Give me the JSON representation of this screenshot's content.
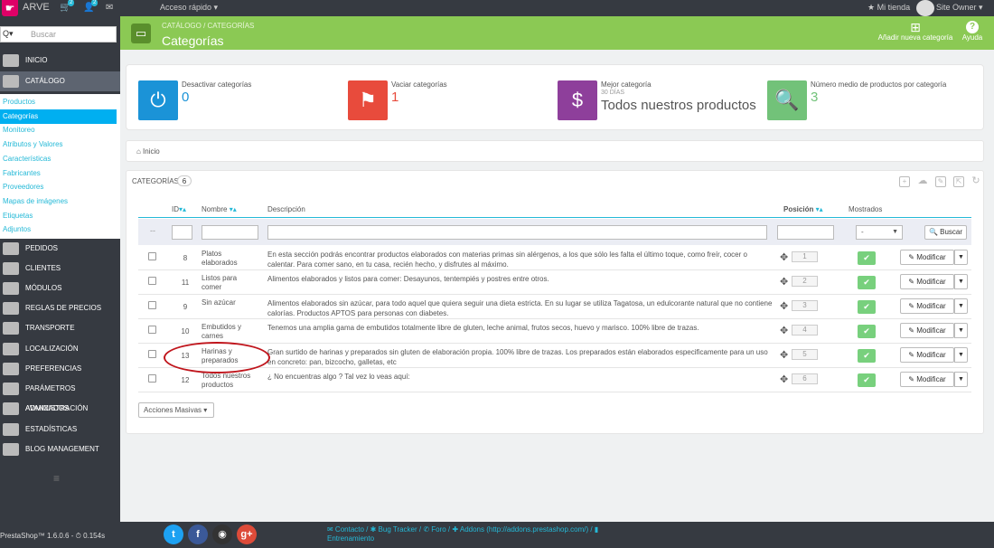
{
  "topbar": {
    "brand": "ARVE",
    "cart_badge": "2",
    "users_badge": "2",
    "quick_access": "Acceso rápido ▾",
    "my_store": "★ Mi tienda",
    "user": "Site Owner ▾"
  },
  "sidebar": {
    "search_placeholder": "Buscar",
    "search_button": "Q▾",
    "main": [
      {
        "label": "INICIO",
        "icon": "dashboard-icon"
      },
      {
        "label": "CATÁLOGO",
        "icon": "book-icon"
      },
      {
        "label": "PEDIDOS",
        "icon": "credit-card-icon"
      },
      {
        "label": "CLIENTES",
        "icon": "users-icon"
      },
      {
        "label": "MÓDULOS",
        "icon": "puzzle-icon"
      },
      {
        "label": "REGLAS DE PRECIOS",
        "icon": "tags-icon"
      },
      {
        "label": "TRANSPORTE",
        "icon": "truck-icon"
      },
      {
        "label": "LOCALIZACIÓN",
        "icon": "globe-icon"
      },
      {
        "label": "PREFERENCIAS",
        "icon": "wrench-icon"
      },
      {
        "label": "PARÁMETROS AVANZADOS",
        "icon": "cogs-icon"
      },
      {
        "label": "ADMINISTRACIÓN",
        "icon": "gear-icon"
      },
      {
        "label": "ESTADÍSTICAS",
        "icon": "bar-chart-icon"
      },
      {
        "label": "BLOG MANAGEMENT",
        "icon": "pencil-icon"
      }
    ],
    "submenu": [
      "Productos",
      "Categorías",
      "Monitoreo",
      "Atributos y Valores",
      "Características",
      "Fabricantes",
      "Proveedores",
      "Mapas de imágenes",
      "Etiquetas",
      "Adjuntos"
    ]
  },
  "header": {
    "breadcrumb": "CATÁLOGO  /  CATEGORÍAS",
    "title": "Categorías",
    "add_label": "Añadir nueva categoría",
    "help_label": "Ayuda"
  },
  "kpis": [
    {
      "title": "Desactivar categorías",
      "value": "0",
      "color": "#1b93d7",
      "icon": "power-icon",
      "sub": ""
    },
    {
      "title": "Vaciar categorías",
      "value": "1",
      "color": "#e84b3c",
      "icon": "bookmark-icon",
      "sub": ""
    },
    {
      "title": "Mejor categoría",
      "sub": "30 DÍAS",
      "value": "Todos nuestros productos",
      "color": "#8e3f9b",
      "icon": "money-icon"
    },
    {
      "title": "Número medio de productos por categoría",
      "value": "3",
      "color": "#72c279",
      "icon": "search-icon",
      "sub": ""
    }
  ],
  "breadcrumb_home": "⌂ Inicio",
  "table": {
    "title": "CATEGORÍAS",
    "count": "6",
    "headers": {
      "id": "ID",
      "name": "Nombre",
      "desc": "Descripción",
      "pos": "Posición",
      "shown": "Mostrados"
    },
    "filter_select": "-",
    "filter_button": "Buscar",
    "rows": [
      {
        "id": "8",
        "name": "Platos elaborados",
        "desc": "En esta sección podrás encontrar productos elaborados con materias primas sin alérgenos, a los que sólo les falta el último toque, como freír, cocer o calentar. Para comer sano, en tu casa, recién hecho, y disfrutes al máximo.",
        "pos": "1"
      },
      {
        "id": "11",
        "name": "Listos para comer",
        "desc": "Alimentos elaborados y listos para comer: Desayunos, tentempiés y postres entre otros.",
        "pos": "2"
      },
      {
        "id": "9",
        "name": "Sin azúcar",
        "desc": "Alimentos elaborados sin azúcar, para todo aquel que quiera seguir una dieta estricta. En su lugar se utiliza Tagatosa, un edulcorante natural que no contiene calorías.   Productos APTOS para personas con diabetes.",
        "pos": "3"
      },
      {
        "id": "10",
        "name": "Embutidos y carnes",
        "desc": "Tenemos una amplia gama de embutidos totalmente libre de gluten, leche animal, frutos secos, huevo y marisco. 100% libre de trazas.",
        "pos": "4"
      },
      {
        "id": "13",
        "name": "Harinas y preparados",
        "desc": "Gran surtido de harinas y preparados sin gluten de elaboración propia. 100% libre de trazas. Los preparados están elaborados especificamente para un uso en concreto: pan, bizcocho, galletas, etc",
        "pos": "5"
      },
      {
        "id": "12",
        "name": "Todos nuestros productos",
        "desc": "¿ No encuentras algo ? Tal vez lo veas aquí:",
        "pos": "6"
      }
    ],
    "modify_label": "✎ Modificar",
    "bulk_label": "Acciones Masivas ▾"
  },
  "footer": {
    "version": "PrestaShop™ 1.6.0.6 - ⏱ 0.154s",
    "links": "✉ Contacto / ✱ Bug Tracker / ✆ Foro / ✚ Addons (http://addons.prestashop.com/) / ▮ Entrenamiento"
  }
}
